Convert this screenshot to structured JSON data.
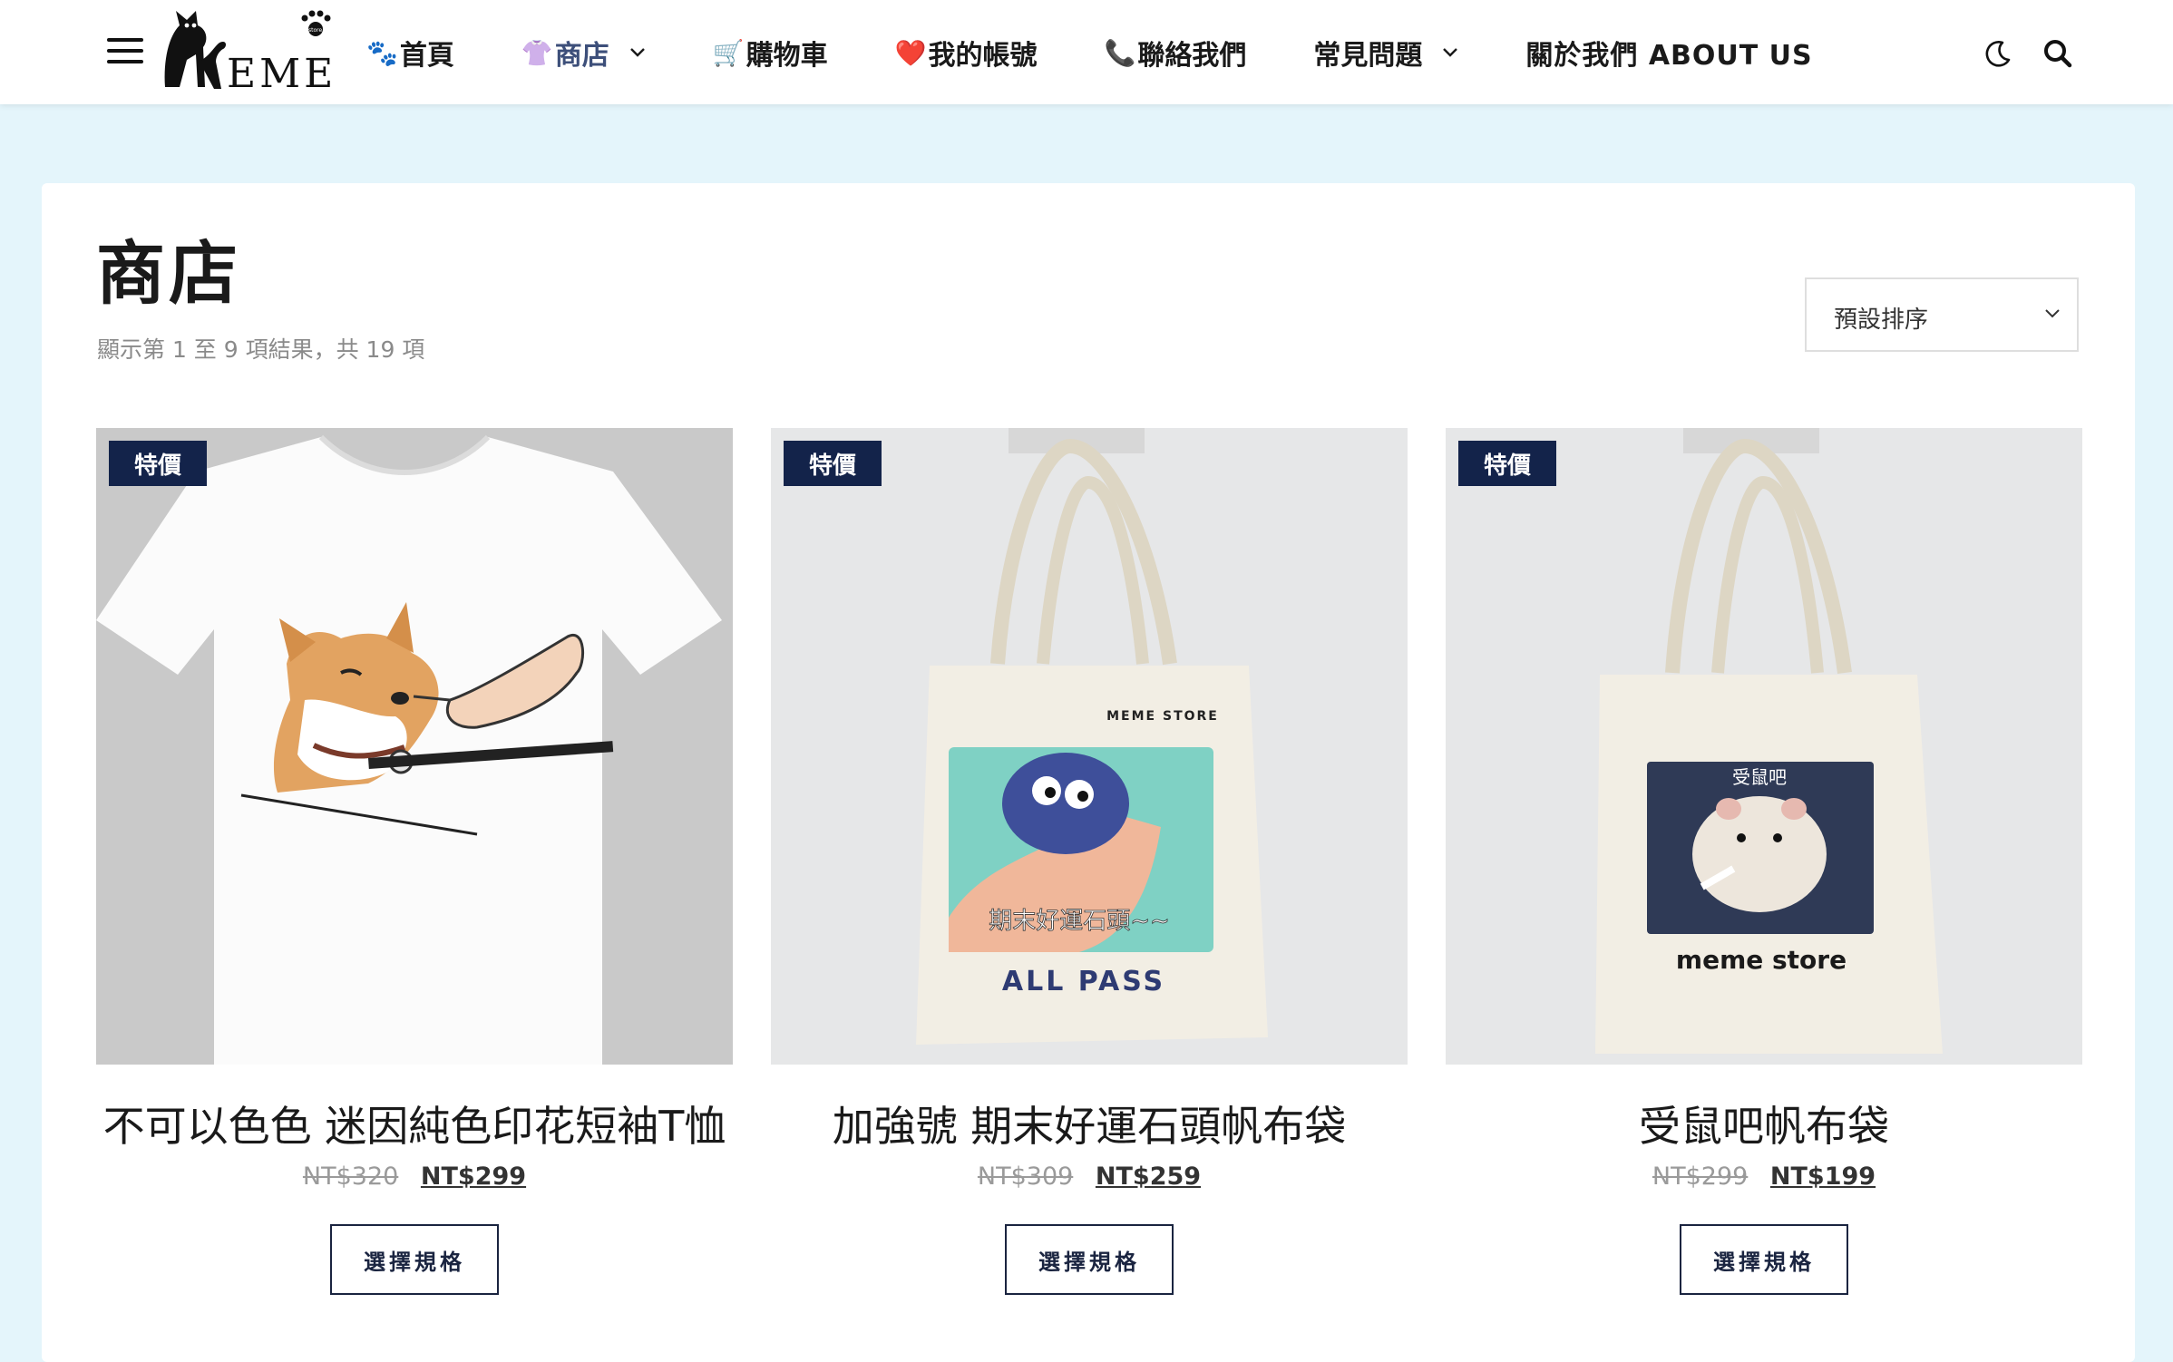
{
  "header": {
    "brand": "MEME",
    "brand_tag": "store",
    "nav": [
      {
        "emoji": "🐾",
        "label": "首頁"
      },
      {
        "emoji": "👚",
        "label": "商店",
        "has_dropdown": true
      },
      {
        "emoji": "🛒",
        "label": "購物車"
      },
      {
        "emoji": "❤️",
        "label": "我的帳號"
      },
      {
        "emoji": "📞",
        "label": "聯絡我們"
      },
      {
        "emoji": "",
        "label": "常見問題",
        "has_dropdown": true
      },
      {
        "emoji": "",
        "label": "關於我們 ABOUT US"
      }
    ],
    "active_nav_index": 1,
    "icons": [
      "menu-icon",
      "moon-icon",
      "search-icon"
    ]
  },
  "page": {
    "title": "商店",
    "result_count": "顯示第 1 至 9 項結果，共 19 項",
    "sort": {
      "selected": "預設排序"
    }
  },
  "products": [
    {
      "badge": "特價",
      "title": "不可以色色 迷因純色印花短袖T恤",
      "old_price": "NT$320",
      "new_price": "NT$299",
      "button": "選擇規格"
    },
    {
      "badge": "特價",
      "title": "加強號 期末好運石頭帆布袋",
      "old_price": "NT$309",
      "new_price": "NT$259",
      "button": "選擇規格",
      "print_brand": "MEME STORE",
      "print_caption": "期末好運石頭~~",
      "print_footer": "ALL PASS"
    },
    {
      "badge": "特價",
      "title": "受鼠吧帆布袋",
      "old_price": "NT$299",
      "new_price": "NT$199",
      "button": "選擇規格",
      "print_caption": "受鼠吧",
      "print_footer": "meme store"
    }
  ],
  "colors": {
    "page_bg": "#e4f5fb",
    "badge_bg": "#13234a",
    "active_nav": "#3d4f7a"
  }
}
